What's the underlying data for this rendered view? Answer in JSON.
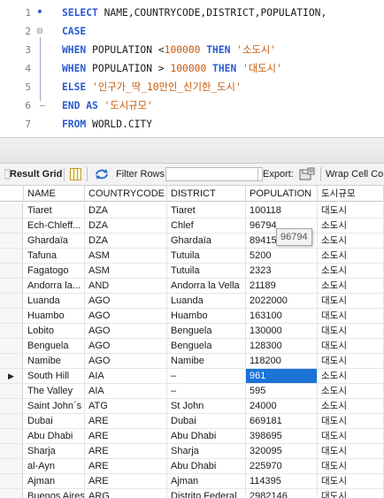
{
  "editor": {
    "line_numbers": [
      "1",
      "2",
      "3",
      "4",
      "5",
      "6",
      "7"
    ],
    "lines": [
      [
        {
          "t": "SELECT ",
          "c": "kw"
        },
        {
          "t": "NAME,COUNTRYCODE,DISTRICT,POPULATION,",
          "c": "id"
        }
      ],
      [
        {
          "t": "CASE",
          "c": "kw"
        }
      ],
      [
        {
          "t": "WHEN ",
          "c": "kw"
        },
        {
          "t": "POPULATION <",
          "c": "id"
        },
        {
          "t": "100000",
          "c": "num"
        },
        {
          "t": " THEN ",
          "c": "kw"
        },
        {
          "t": "'소도시'",
          "c": "str"
        }
      ],
      [
        {
          "t": "WHEN ",
          "c": "kw"
        },
        {
          "t": "POPULATION > ",
          "c": "id"
        },
        {
          "t": "100000",
          "c": "num"
        },
        {
          "t": " THEN ",
          "c": "kw"
        },
        {
          "t": "'대도시'",
          "c": "str"
        }
      ],
      [
        {
          "t": "ELSE ",
          "c": "kw"
        },
        {
          "t": "'인구가_딱_10만인_신기한_도시'",
          "c": "str"
        }
      ],
      [
        {
          "t": "END ",
          "c": "kw"
        },
        {
          "t": "AS ",
          "c": "kw"
        },
        {
          "t": "'도시규모'",
          "c": "str"
        }
      ],
      [
        {
          "t": "FROM ",
          "c": "kw"
        },
        {
          "t": "WORLD.CITY",
          "c": "id"
        }
      ]
    ]
  },
  "toolbar": {
    "result_grid_label": "Result Grid",
    "filter_rows_label": "Filter Rows:",
    "filter_value": "",
    "export_label": "Export:",
    "wrap_label": "Wrap Cell Con"
  },
  "grid": {
    "columns": [
      "NAME",
      "COUNTRYCODE",
      "DISTRICT",
      "POPULATION",
      "도시규모"
    ],
    "rows": [
      [
        "Tiaret",
        "DZA",
        "Tiaret",
        "100118",
        "대도시"
      ],
      [
        "Ech-Chleff...",
        "DZA",
        "Chlef",
        "96794",
        "소도시"
      ],
      [
        "Ghardaïa",
        "DZA",
        "Ghardaïa",
        "89415",
        "소도시"
      ],
      [
        "Tafuna",
        "ASM",
        "Tutuila",
        "5200",
        "소도시"
      ],
      [
        "Fagatogo",
        "ASM",
        "Tutuila",
        "2323",
        "소도시"
      ],
      [
        "Andorra la...",
        "AND",
        "Andorra la Vella",
        "21189",
        "소도시"
      ],
      [
        "Luanda",
        "AGO",
        "Luanda",
        "2022000",
        "대도시"
      ],
      [
        "Huambo",
        "AGO",
        "Huambo",
        "163100",
        "대도시"
      ],
      [
        "Lobito",
        "AGO",
        "Benguela",
        "130000",
        "대도시"
      ],
      [
        "Benguela",
        "AGO",
        "Benguela",
        "128300",
        "대도시"
      ],
      [
        "Namibe",
        "AGO",
        "Namibe",
        "118200",
        "대도시"
      ],
      [
        "South Hill",
        "AIA",
        "–",
        "961",
        "소도시"
      ],
      [
        "The Valley",
        "AIA",
        "–",
        "595",
        "소도시"
      ],
      [
        "Saint John´s",
        "ATG",
        "St John",
        "24000",
        "소도시"
      ],
      [
        "Dubai",
        "ARE",
        "Dubai",
        "669181",
        "대도시"
      ],
      [
        "Abu Dhabi",
        "ARE",
        "Abu Dhabi",
        "398695",
        "대도시"
      ],
      [
        "Sharja",
        "ARE",
        "Sharja",
        "320095",
        "대도시"
      ],
      [
        "al-Ayn",
        "ARE",
        "Abu Dhabi",
        "225970",
        "대도시"
      ],
      [
        "Ajman",
        "ARE",
        "Ajman",
        "114395",
        "대도시"
      ],
      [
        "Buenos Aires",
        "ARG",
        "Distrito Federal",
        "2982146",
        "대도시"
      ]
    ],
    "selected_row": 11,
    "selected_col": 3,
    "tooltip": "96794"
  },
  "colors": {
    "keyword": "#2a5ad0",
    "literal": "#c8580a",
    "selection": "#1c73d6"
  }
}
